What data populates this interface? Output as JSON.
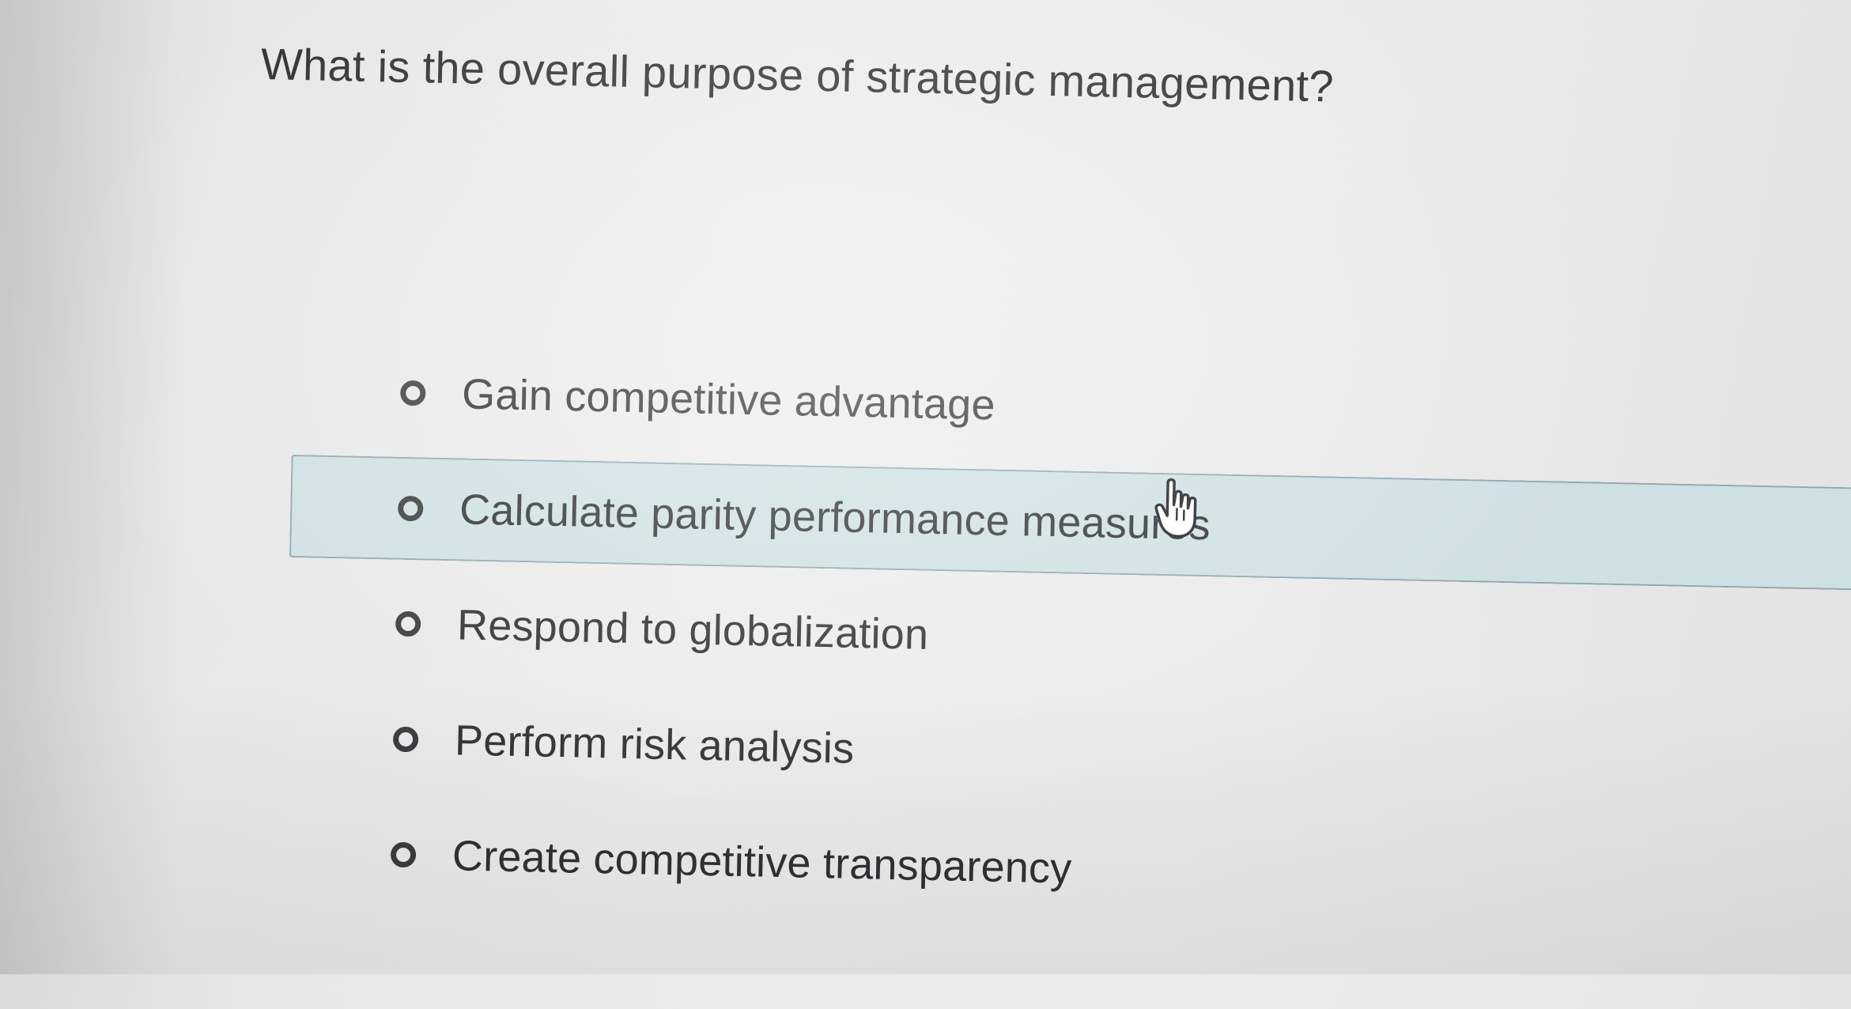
{
  "question": {
    "text": "What is the overall purpose of strategic management?"
  },
  "options": [
    {
      "label": "Gain competitive advantage",
      "selected": false
    },
    {
      "label": "Calculate parity performance measures",
      "selected": false,
      "hovered": true
    },
    {
      "label": "Respond to globalization",
      "selected": false
    },
    {
      "label": "Perform risk analysis",
      "selected": false
    },
    {
      "label": "Create competitive transparency",
      "selected": false
    }
  ],
  "colors": {
    "background": "#eaebea",
    "hover_fill": "#cfe0e4",
    "hover_border": "#8aa9b1",
    "text": "#2f3234"
  },
  "icons": {
    "radio": "radio-unchecked-icon",
    "cursor": "hand-pointer-cursor-icon"
  }
}
